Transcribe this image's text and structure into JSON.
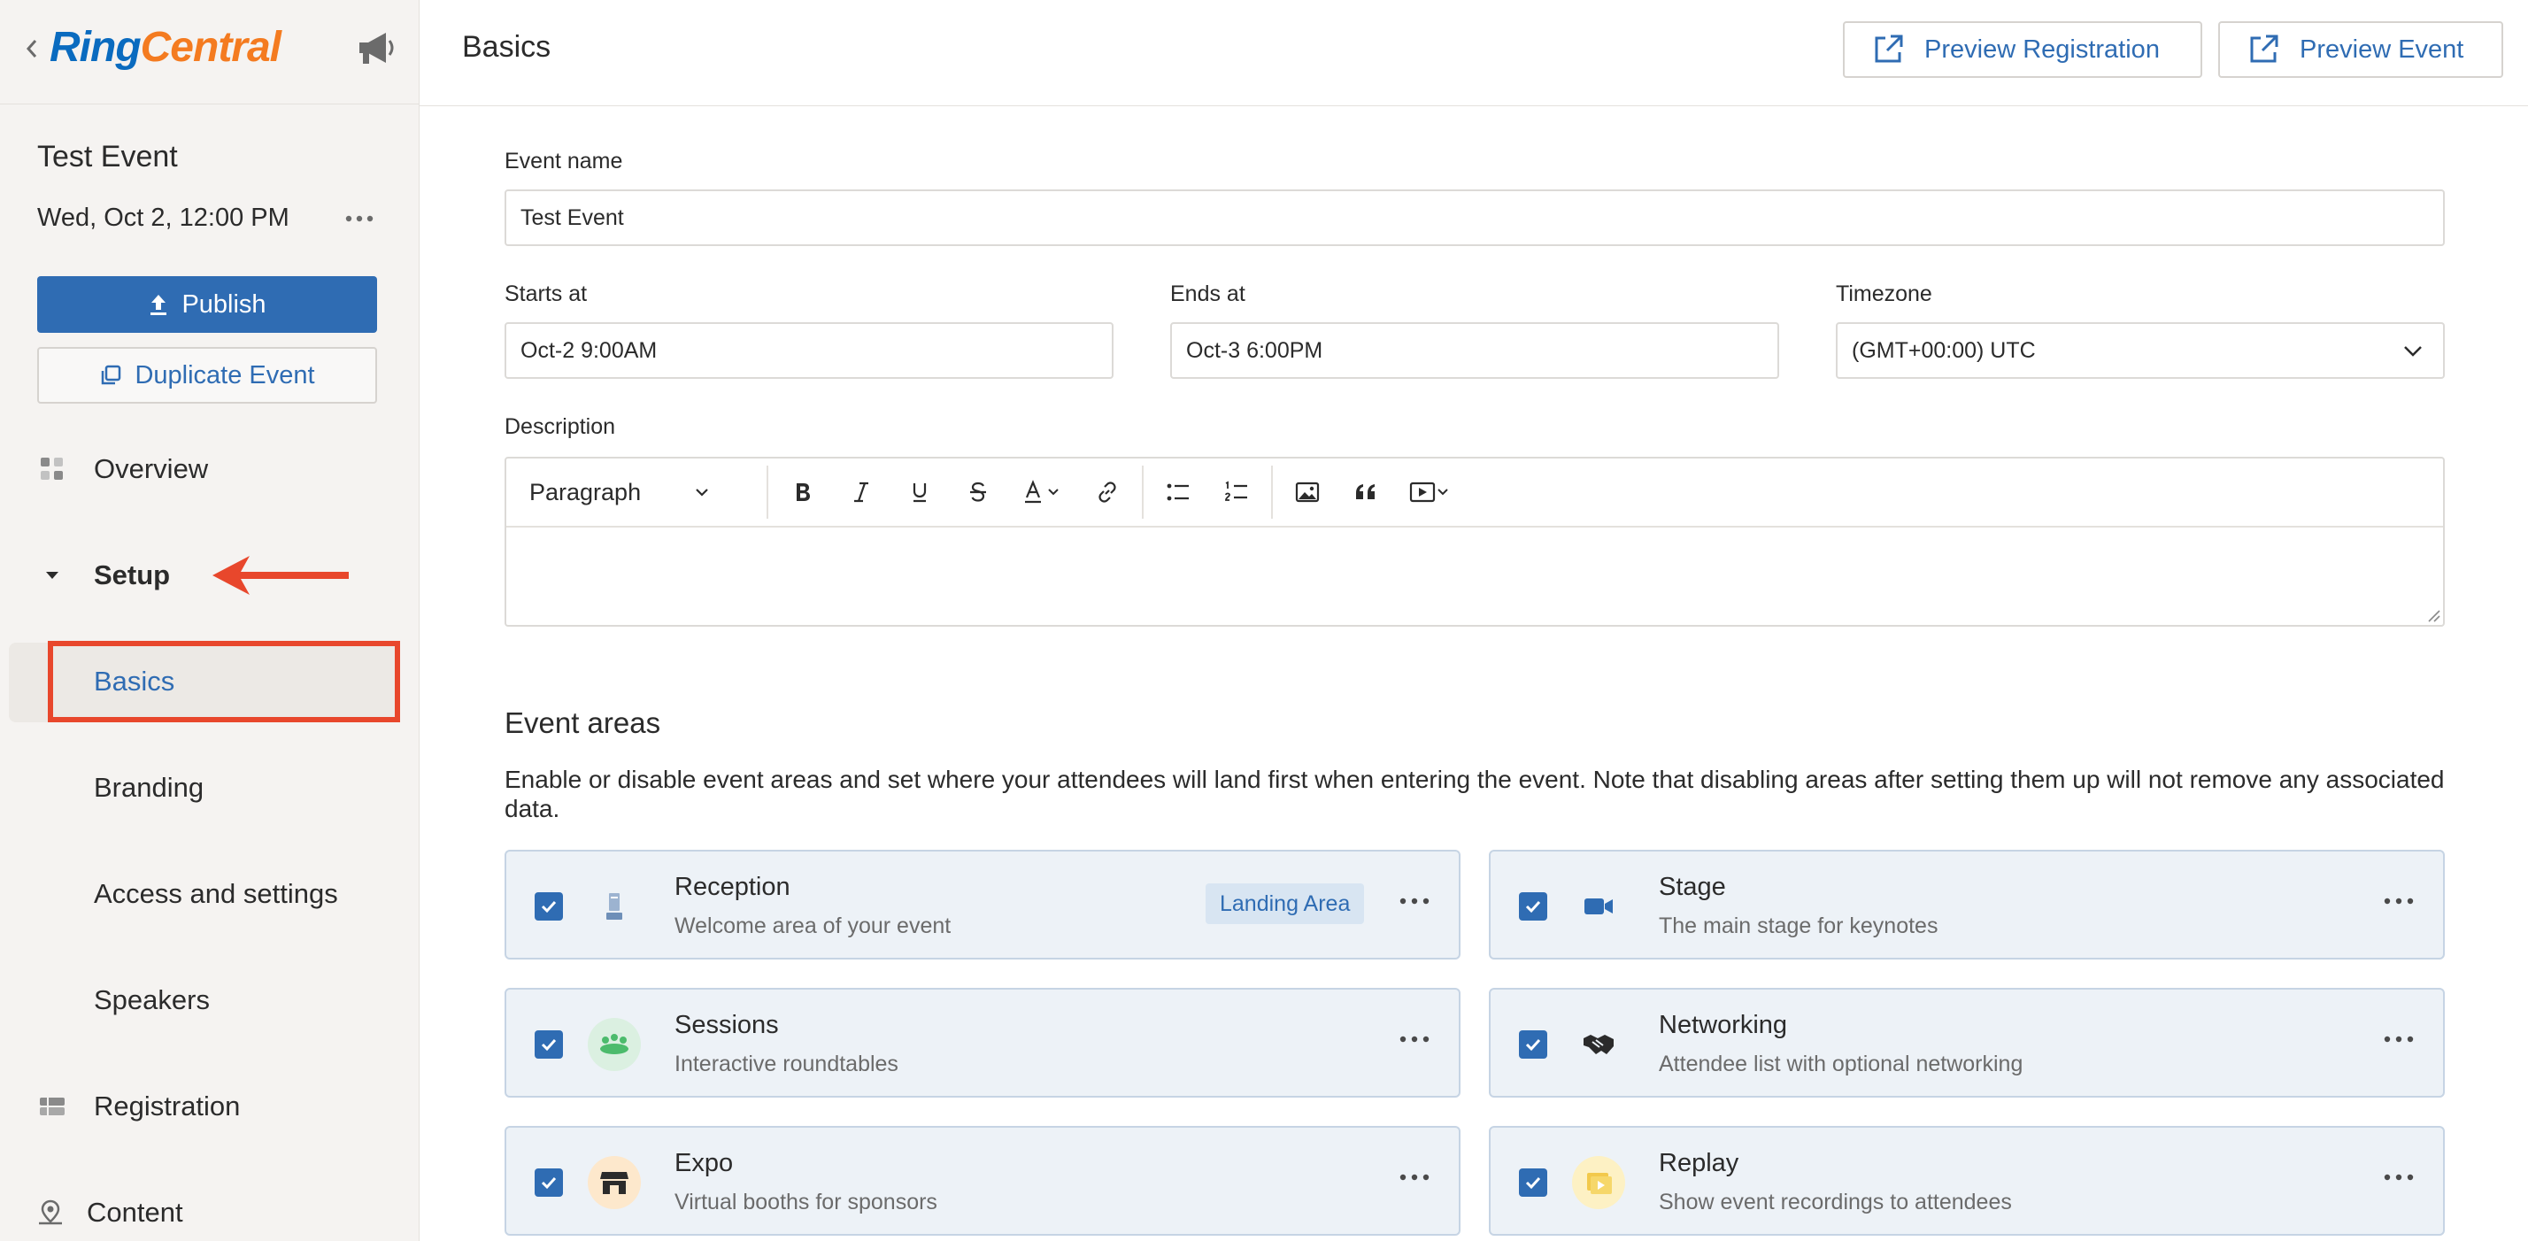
{
  "brand": {
    "logo_part1": "Ring",
    "logo_part2": "Central"
  },
  "event": {
    "title": "Test Event",
    "datetime": "Wed, Oct 2, 12:00 PM"
  },
  "sidebar": {
    "publish_label": "Publish",
    "duplicate_label": "Duplicate Event",
    "overview": "Overview",
    "setup": "Setup",
    "sub_items": [
      "Basics",
      "Branding",
      "Access and settings",
      "Speakers"
    ],
    "registration": "Registration",
    "content": "Content"
  },
  "header": {
    "title": "Basics",
    "preview_registration": "Preview Registration",
    "preview_event": "Preview Event"
  },
  "form": {
    "event_name_label": "Event name",
    "event_name_value": "Test Event",
    "starts_label": "Starts at",
    "starts_value": "Oct-2 9:00AM",
    "ends_label": "Ends at",
    "ends_value": "Oct-3 6:00PM",
    "timezone_label": "Timezone",
    "timezone_value": "(GMT+00:00) UTC",
    "description_label": "Description",
    "paragraph_style": "Paragraph"
  },
  "event_areas": {
    "title": "Event areas",
    "description": "Enable or disable event areas and set where your attendees will land first when entering the event. Note that disabling areas after setting them up will not remove any associated data.",
    "landing_badge": "Landing Area",
    "cards": [
      {
        "title": "Reception",
        "desc": "Welcome area of your event",
        "checked": true,
        "icon": "reception-icon"
      },
      {
        "title": "Stage",
        "desc": "The main stage for keynotes",
        "checked": true,
        "icon": "video-camera-icon"
      },
      {
        "title": "Sessions",
        "desc": "Interactive roundtables",
        "checked": true,
        "icon": "roundtable-icon"
      },
      {
        "title": "Networking",
        "desc": "Attendee list with optional networking",
        "checked": true,
        "icon": "handshake-icon"
      },
      {
        "title": "Expo",
        "desc": "Virtual booths for sponsors",
        "checked": true,
        "icon": "booth-icon"
      },
      {
        "title": "Replay",
        "desc": "Show event recordings to attendees",
        "checked": true,
        "icon": "replay-icon"
      }
    ]
  },
  "colors": {
    "accent": "#2f6cb3",
    "highlight": "#e8472c",
    "card_bg": "#edf2f7"
  }
}
